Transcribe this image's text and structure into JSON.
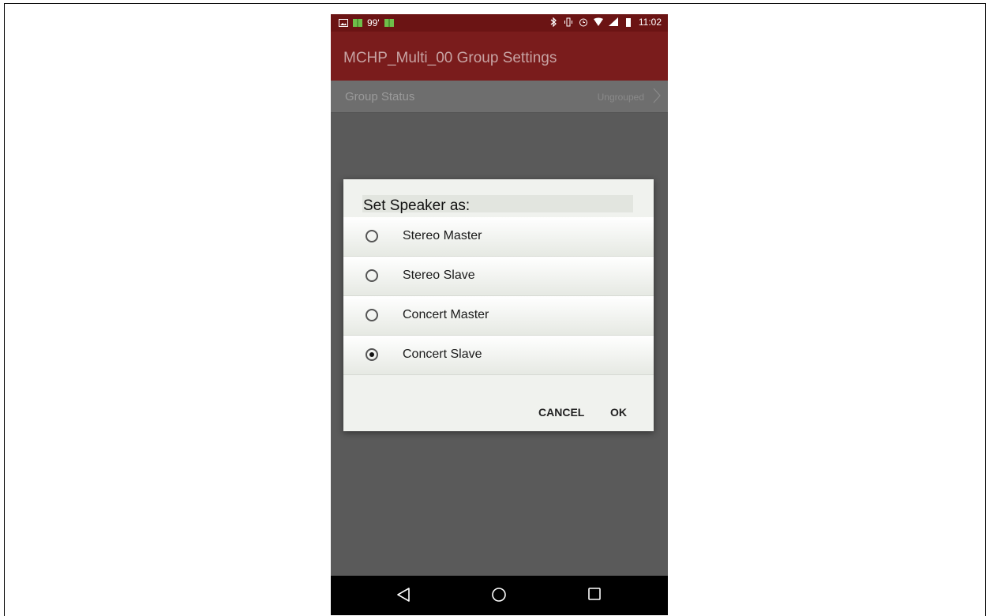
{
  "status_bar": {
    "notification_icons": [
      "image-icon",
      "book-icon",
      "badge-99",
      "book-icon"
    ],
    "badge_text": "99'",
    "status_icons": [
      "bluetooth-icon",
      "vibrate-icon",
      "alarm-icon",
      "wifi-icon",
      "signal-icon",
      "battery-icon"
    ],
    "time": "11:02"
  },
  "app_bar": {
    "title": "MCHP_Multi_00 Group Settings"
  },
  "settings": {
    "group_status_label": "Group Status",
    "group_status_value": "Ungrouped"
  },
  "dialog": {
    "title": "Set Speaker as:",
    "options": [
      {
        "label": "Stereo Master",
        "selected": false
      },
      {
        "label": "Stereo Slave",
        "selected": false
      },
      {
        "label": "Concert Master",
        "selected": false
      },
      {
        "label": "Concert Slave",
        "selected": true
      }
    ],
    "cancel_label": "CANCEL",
    "ok_label": "OK"
  },
  "nav_bar": {
    "icons": [
      "back-icon",
      "home-icon",
      "recents-icon"
    ]
  },
  "colors": {
    "app_bar": "#7a1c1c",
    "status_bar": "#6b1414",
    "scrim": "#5a5a5a",
    "dialog_bg": "#f0f2ee"
  }
}
